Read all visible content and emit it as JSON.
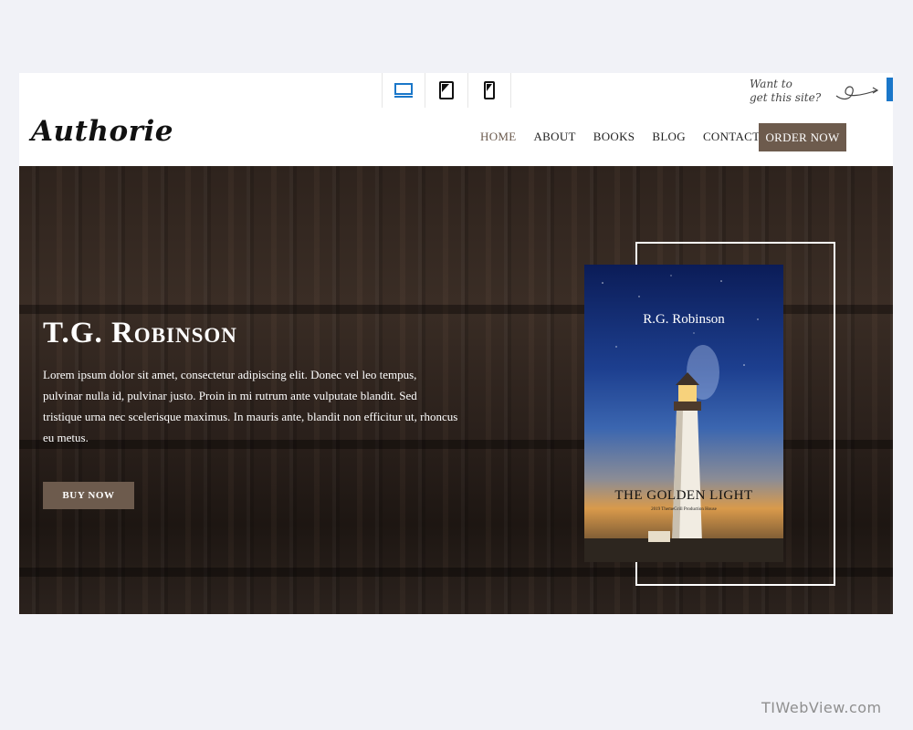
{
  "preview_bar": {
    "devices": [
      {
        "icon": "desktop-icon",
        "active": true
      },
      {
        "icon": "tablet-icon",
        "active": false
      },
      {
        "icon": "mobile-icon",
        "active": false
      }
    ],
    "cta_line1": "Want to",
    "cta_line2": "get this site?"
  },
  "site": {
    "logo": "Authorie",
    "nav": [
      "HOME",
      "ABOUT",
      "BOOKS",
      "BLOG",
      "CONTACT"
    ],
    "active_nav": "HOME",
    "order_button": "ORDER NOW"
  },
  "hero": {
    "name": "T.G. Robinson",
    "text": "Lorem ipsum dolor sit amet, consectetur adipiscing elit. Donec vel leo tempus, pulvinar nulla id, pulvinar justo. Proin in mi rutrum ante vulputate blandit. Sed tristique urna nec scelerisque maximus. In mauris ante, blandit non efficitur ut, rhoncus eu metus.",
    "buy_button": "BUY NOW"
  },
  "book_cover": {
    "author": "R.G. Robinson",
    "title": "THE GOLDEN LIGHT",
    "subtitle": "2019 ThemeGrill Production House"
  },
  "colors": {
    "accent_brown": "#6d5b4d",
    "preview_blue": "#1a77c9",
    "page_bg": "#f1f2f7"
  },
  "watermark": "TIWebView.com"
}
